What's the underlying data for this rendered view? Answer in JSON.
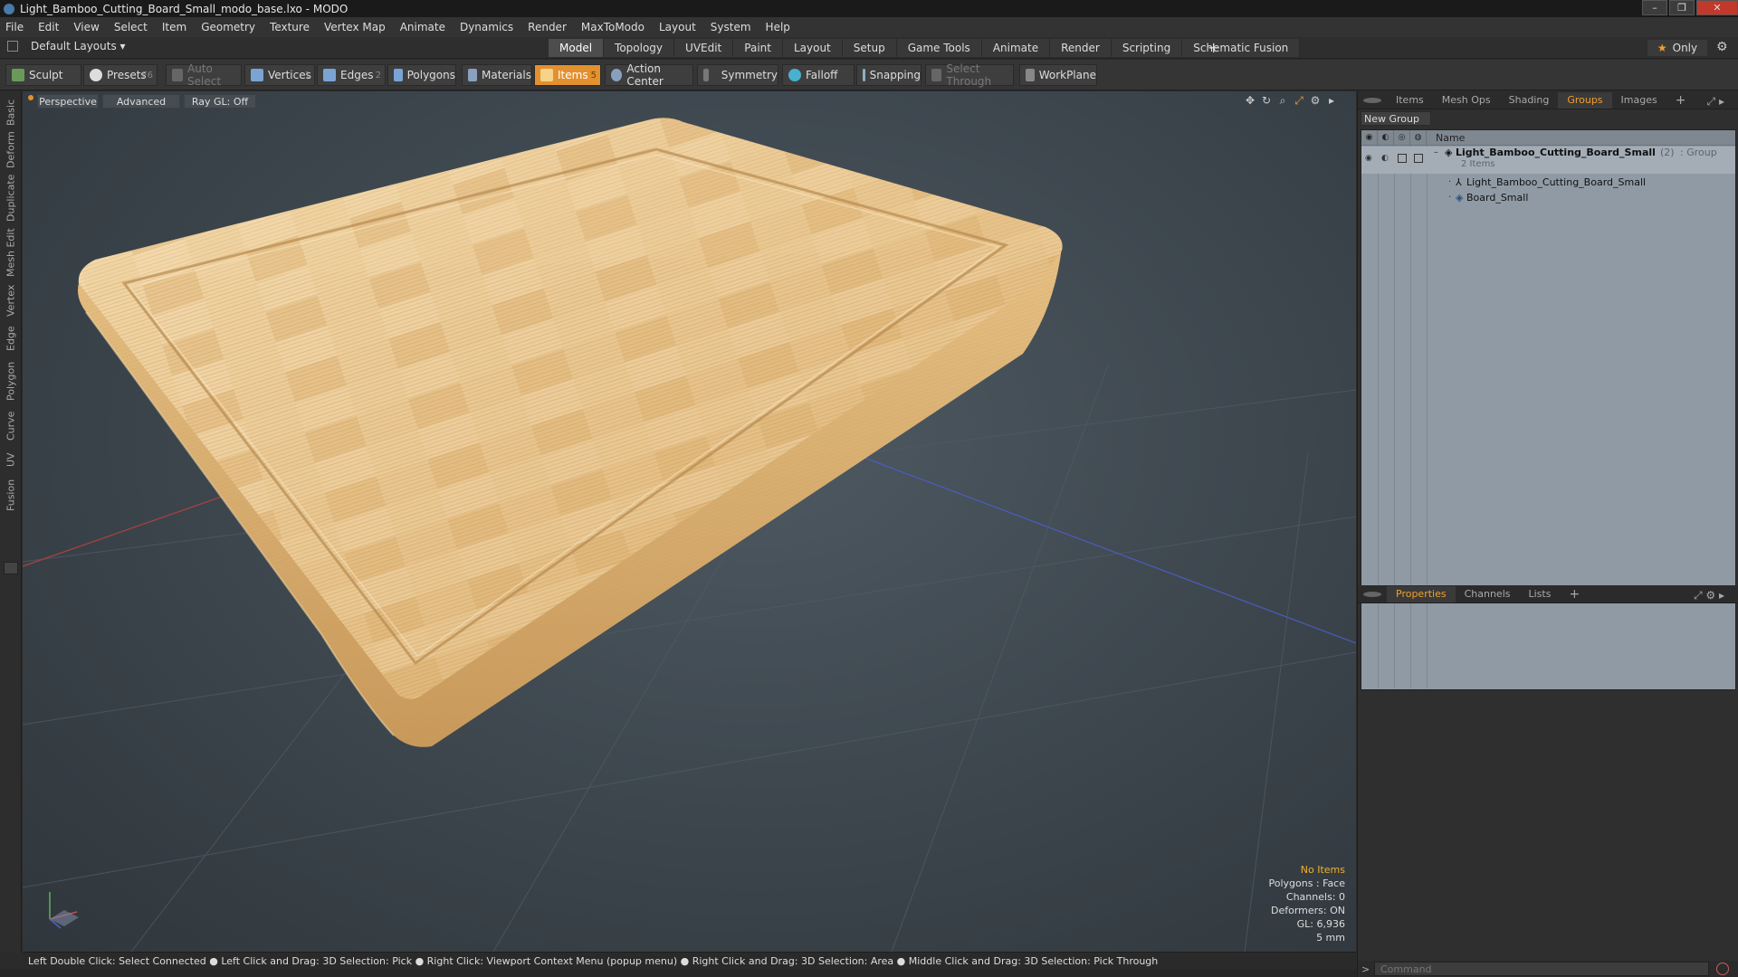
{
  "window": {
    "title": "Light_Bamboo_Cutting_Board_Small_modo_base.lxo - MODO",
    "controls": [
      "–",
      "❐",
      "✕"
    ]
  },
  "menu": [
    "File",
    "Edit",
    "View",
    "Select",
    "Item",
    "Geometry",
    "Texture",
    "Vertex Map",
    "Animate",
    "Dynamics",
    "Render",
    "MaxToModo",
    "Layout",
    "System",
    "Help"
  ],
  "layout_selector": "Default Layouts ▾",
  "mode_tabs": [
    {
      "label": "Model",
      "active": true
    },
    {
      "label": "Topology"
    },
    {
      "label": "UVEdit"
    },
    {
      "label": "Paint"
    },
    {
      "label": "Layout"
    },
    {
      "label": "Setup"
    },
    {
      "label": "Game Tools"
    },
    {
      "label": "Animate"
    },
    {
      "label": "Render"
    },
    {
      "label": "Scripting"
    },
    {
      "label": "Schematic Fusion"
    }
  ],
  "only_label": "Only",
  "toolbar": {
    "sculpt": "Sculpt",
    "presets": "Presets",
    "presets_key": "F6",
    "auto_select": "Auto Select",
    "vertices": "Vertices",
    "vertices_count": "1",
    "edges": "Edges",
    "edges_count": "2",
    "polygons": "Polygons",
    "materials": "Materials",
    "items": "Items",
    "items_count": "5",
    "action_center": "Action Center",
    "symmetry": "Symmetry",
    "falloff": "Falloff",
    "snapping": "Snapping",
    "select_through": "Select Through",
    "workplane": "WorkPlane"
  },
  "left_tabs": [
    "Basic",
    "Deform",
    "Duplicate",
    "Mesh Edit",
    "Vertex",
    "Edge",
    "Polygon",
    "Curve",
    "UV",
    "Fusion"
  ],
  "viewport": {
    "view": "Perspective",
    "shading": "Advanced",
    "raygl": "Ray GL: Off",
    "stats": {
      "selection": "No Items",
      "polygons": "Polygons : Face",
      "channels": "Channels: 0",
      "deformers": "Deformers: ON",
      "gl": "GL: 6,936",
      "scale": "5 mm"
    }
  },
  "status_text": "Left Double Click: Select Connected ● Left Click and Drag: 3D Selection: Pick ● Right Click: Viewport Context Menu (popup menu) ● Right Click and Drag: 3D Selection: Area ● Middle Click and Drag: 3D Selection: Pick Through",
  "right_panel": {
    "top_tabs": [
      {
        "label": "Items"
      },
      {
        "label": "Mesh Ops"
      },
      {
        "label": "Shading"
      },
      {
        "label": "Groups",
        "active": true
      },
      {
        "label": "Images"
      }
    ],
    "new_group": "New Group",
    "tree_header": "Name",
    "group_name": "Light_Bamboo_Cutting_Board_Small",
    "group_count": "(2)",
    "group_type": ": Group",
    "group_items": "2 Items",
    "children": [
      "Light_Bamboo_Cutting_Board_Small",
      "Board_Small"
    ],
    "bottom_tabs": [
      {
        "label": "Properties",
        "active": true
      },
      {
        "label": "Channels"
      },
      {
        "label": "Lists"
      }
    ],
    "command_placeholder": "Command"
  },
  "colors": {
    "accent": "#e3902e",
    "tree_bg": "#909aa4",
    "viewport_bg": "#3c454c"
  }
}
